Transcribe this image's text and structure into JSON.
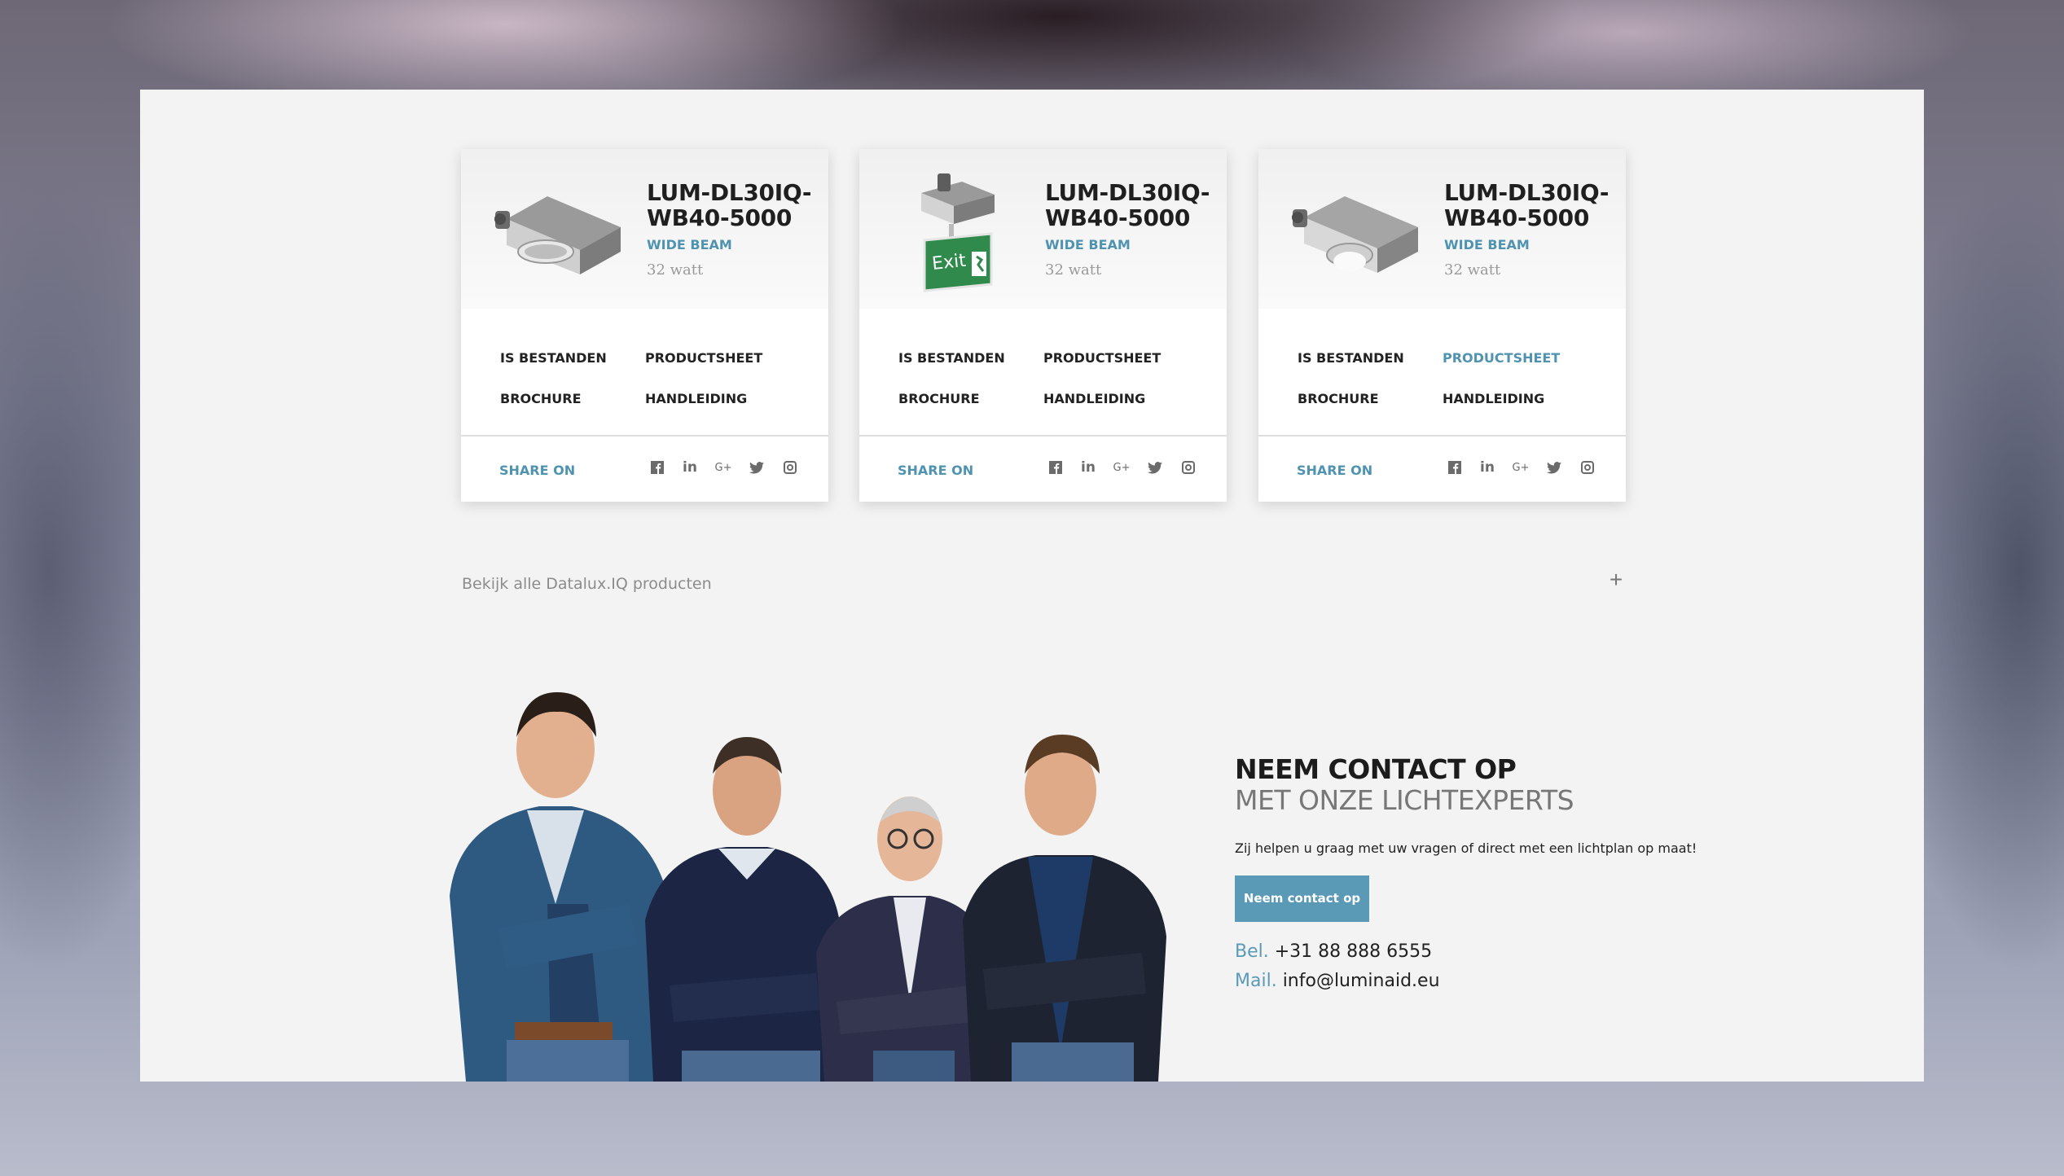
{
  "cards": [
    {
      "title": "LUM-DL30IQ-WB40-5000",
      "beam": "WIDE BEAM",
      "watt": "32 watt",
      "links": [
        "IS BESTANDEN",
        "PRODUCTSHEET",
        "BROCHURE",
        "HANDLEIDING"
      ],
      "share": "SHARE ON"
    },
    {
      "title": "LUM-DL30IQ-WB40-5000",
      "beam": "WIDE BEAM",
      "watt": "32 watt",
      "exit_label": "Exit",
      "links": [
        "IS BESTANDEN",
        "PRODUCTSHEET",
        "BROCHURE",
        "HANDLEIDING"
      ],
      "share": "SHARE ON"
    },
    {
      "title": "LUM-DL30IQ-WB40-5000",
      "beam": "WIDE BEAM",
      "watt": "32 watt",
      "links": [
        "IS BESTANDEN",
        "PRODUCTSHEET",
        "BROCHURE",
        "HANDLEIDING"
      ],
      "share": "SHARE ON"
    }
  ],
  "social_icons": [
    "facebook-icon",
    "linkedin-icon",
    "google-plus-icon",
    "twitter-icon",
    "instagram-icon"
  ],
  "social_glyphs": [
    "f",
    "in",
    "G+",
    "t",
    "◎"
  ],
  "view_all": {
    "label": "Bekijk alle Datalux.IQ producten",
    "toggle": "+"
  },
  "contact": {
    "heading": "NEEM CONTACT OP",
    "subheading": "MET ONZE LICHTEXPERTS",
    "text": "Zij helpen u graag met uw vragen of direct met een lichtplan op maat!",
    "button": "Neem contact op",
    "phone_label": "Bel.",
    "phone": "+31 88 888 6555",
    "mail_label": "Mail.",
    "mail": "info@luminaid.eu"
  },
  "colors": {
    "accent": "#4f93b1",
    "button": "#5b9ab7",
    "exit_sign": "#2f8a4c"
  }
}
